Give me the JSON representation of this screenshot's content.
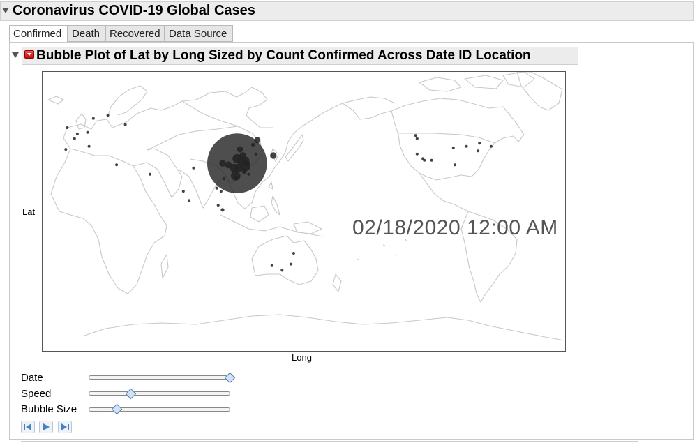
{
  "window": {
    "title": "Coronavirus COVID-19 Global Cases"
  },
  "tabs": [
    {
      "label": "Confirmed",
      "active": true
    },
    {
      "label": "Death",
      "active": false
    },
    {
      "label": "Recovered",
      "active": false
    },
    {
      "label": "Data Source",
      "active": false
    }
  ],
  "report": {
    "title": "Bubble Plot of Lat by Long Sized by Count Confirmed Across Date ID Location",
    "menu_icon": "red-triangle-menu-icon"
  },
  "plot": {
    "xlabel": "Long",
    "ylabel": "Lat",
    "current_date": "02/18/2020 12:00 AM",
    "map_line_color": "#c8c8c8",
    "bubble_color": "#222222"
  },
  "chart_data": {
    "type": "scatter",
    "title": "Bubble Plot of Lat by Long Sized by Count Confirmed Across Date ID Location",
    "xlabel": "Long",
    "ylabel": "Lat",
    "xlim": [
      -20,
      340
    ],
    "ylim": [
      -90,
      90
    ],
    "grid": false,
    "points": [
      {
        "x": 114,
        "y": 31,
        "size": 72000
      },
      {
        "x": 113,
        "y": 23,
        "size": 1300
      },
      {
        "x": 120,
        "y": 29,
        "size": 1150
      },
      {
        "x": 114,
        "y": 34,
        "size": 1200
      },
      {
        "x": 112,
        "y": 28,
        "size": 1000
      },
      {
        "x": 115,
        "y": 28,
        "size": 930
      },
      {
        "x": 117,
        "y": 32,
        "size": 980
      },
      {
        "x": 118,
        "y": 36,
        "size": 540
      },
      {
        "x": 120,
        "y": 33,
        "size": 630
      },
      {
        "x": 108,
        "y": 30,
        "size": 570
      },
      {
        "x": 104,
        "y": 31,
        "size": 500
      },
      {
        "x": 128,
        "y": 46,
        "size": 460
      },
      {
        "x": 116,
        "y": 40,
        "size": 390
      },
      {
        "x": 121,
        "y": 31,
        "size": 330
      },
      {
        "x": 119,
        "y": 26,
        "size": 290
      },
      {
        "x": 125,
        "y": 43,
        "size": 90
      },
      {
        "x": 139,
        "y": 36,
        "size": 500
      },
      {
        "x": 127,
        "y": 37,
        "size": 31
      },
      {
        "x": 104,
        "y": 1,
        "size": 77
      },
      {
        "x": 100,
        "y": 15,
        "size": 35
      },
      {
        "x": 101,
        "y": 4,
        "size": 22
      },
      {
        "x": 105,
        "y": 21,
        "size": 16
      },
      {
        "x": 122,
        "y": 24,
        "size": 22
      },
      {
        "x": 114,
        "y": 22,
        "size": 62
      },
      {
        "x": 113,
        "y": 22,
        "size": 10
      },
      {
        "x": 151,
        "y": -34,
        "size": 4
      },
      {
        "x": 145,
        "y": -38,
        "size": 4
      },
      {
        "x": 138,
        "y": -35,
        "size": 2
      },
      {
        "x": 153,
        "y": -27,
        "size": 5
      },
      {
        "x": 77,
        "y": 13,
        "size": 3
      },
      {
        "x": 81,
        "y": 7,
        "size": 1
      },
      {
        "x": 54,
        "y": 24,
        "size": 9
      },
      {
        "x": 103,
        "y": 13,
        "size": 1
      },
      {
        "x": 84,
        "y": 28,
        "size": 1
      },
      {
        "x": 11,
        "y": 51,
        "size": 16
      },
      {
        "x": 2,
        "y": 47,
        "size": 12
      },
      {
        "x": 12,
        "y": 42,
        "size": 3
      },
      {
        "x": -3,
        "y": 54,
        "size": 9
      },
      {
        "x": 15,
        "y": 60,
        "size": 1
      },
      {
        "x": 25,
        "y": 62,
        "size": 1
      },
      {
        "x": 4,
        "y": 50,
        "size": 1
      },
      {
        "x": -4,
        "y": 40,
        "size": 2
      },
      {
        "x": 31,
        "y": 30,
        "size": 1
      },
      {
        "x": 37,
        "y": 56,
        "size": 2
      },
      {
        "x": -122,
        "y": 47,
        "size": 1
      },
      {
        "x": -122,
        "y": 37,
        "size": 2
      },
      {
        "x": -118,
        "y": 34,
        "size": 1
      },
      {
        "x": -117,
        "y": 33,
        "size": 3
      },
      {
        "x": -112,
        "y": 33,
        "size": 1
      },
      {
        "x": -88,
        "y": 42,
        "size": 2
      },
      {
        "x": -71,
        "y": 42,
        "size": 1
      },
      {
        "x": -79,
        "y": 44,
        "size": 3
      },
      {
        "x": -123,
        "y": 49,
        "size": 1
      },
      {
        "x": -97,
        "y": 41,
        "size": 2
      },
      {
        "x": -96,
        "y": 30,
        "size": 2
      },
      {
        "x": -80,
        "y": 39,
        "size": 1
      }
    ]
  },
  "controls": {
    "date_label": "Date",
    "date_position": 1.0,
    "speed_label": "Speed",
    "speed_position": 0.3,
    "bubble_size_label": "Bubble Size",
    "bubble_size_position": 0.2,
    "thumb_color": "#cfe2f7"
  },
  "playback": [
    {
      "icon": "step-back-icon"
    },
    {
      "icon": "play-icon"
    },
    {
      "icon": "step-forward-icon"
    }
  ]
}
